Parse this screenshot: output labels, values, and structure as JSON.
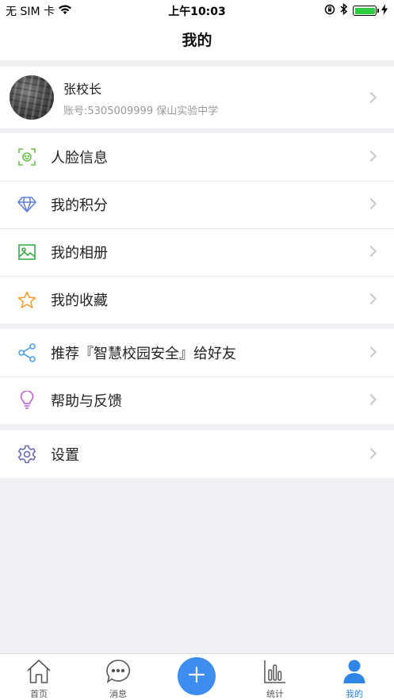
{
  "status_bar": {
    "carrier": "无 SIM 卡",
    "time": "上午10:03",
    "battery_level": 1.0
  },
  "nav": {
    "title": "我的"
  },
  "profile": {
    "name": "张校长",
    "account": "账号:5305009999 保山实验中学"
  },
  "menu_groups": [
    [
      {
        "label": "人脸信息",
        "icon": "face-scan-icon",
        "color": "#6cc04a"
      },
      {
        "label": "我的积分",
        "icon": "diamond-icon",
        "color": "#5b7fd6"
      },
      {
        "label": "我的相册",
        "icon": "image-icon",
        "color": "#3bab4a"
      },
      {
        "label": "我的收藏",
        "icon": "star-icon",
        "color": "#f0a030"
      }
    ],
    [
      {
        "label": "推荐『智慧校园安全』给好友",
        "icon": "share-icon",
        "color": "#4a9ee8"
      },
      {
        "label": "帮助与反馈",
        "icon": "lightbulb-icon",
        "color": "#c05ad6"
      }
    ],
    [
      {
        "label": "设置",
        "icon": "gear-icon",
        "color": "#6a6ab8"
      }
    ]
  ],
  "tab_bar": {
    "tabs": [
      {
        "label": "首页",
        "icon": "home-icon",
        "active": false
      },
      {
        "label": "消息",
        "icon": "message-icon",
        "active": false
      },
      {
        "label": "统计",
        "icon": "stats-icon",
        "active": false
      },
      {
        "label": "我的",
        "icon": "user-icon",
        "active": true
      }
    ],
    "add_icon": "plus-icon",
    "active_color": "#2f86e5",
    "add_color": "#3d8ef0"
  }
}
